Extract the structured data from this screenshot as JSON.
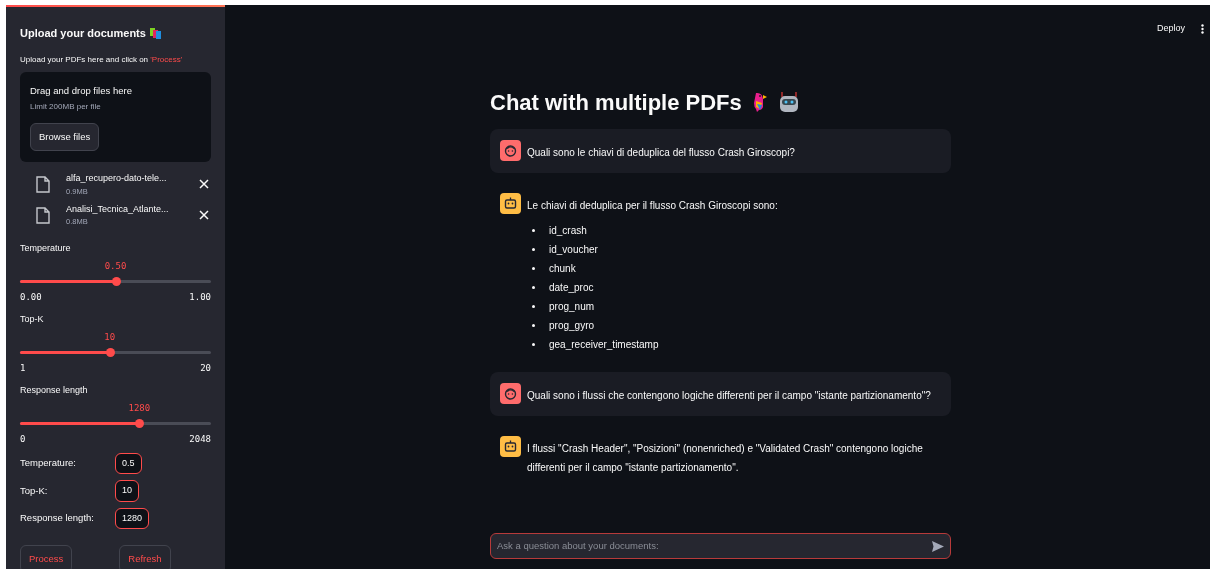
{
  "sidebar": {
    "title": "Upload your documents",
    "hint": {
      "text": "Upload your PDFs here and click on ",
      "highlight": "'Process'"
    },
    "dropzone": {
      "title": "Drag and drop files here",
      "limit": "Limit 200MB per file",
      "button": "Browse files"
    },
    "files": [
      {
        "name": "alfa_recupero-dato-tele...",
        "size": "0.9MB"
      },
      {
        "name": "Analisi_Tecnica_Atlante...",
        "size": "0.8MB"
      }
    ],
    "sliders": [
      {
        "label": "Temperature",
        "reading": "0.50",
        "min": "0.00",
        "max": "1.00",
        "level": 0.5
      },
      {
        "label": "Top-K",
        "reading": "10",
        "min": "1",
        "max": "20",
        "level": 0.47
      },
      {
        "label": "Response length",
        "reading": "1280",
        "min": "0",
        "max": "2048",
        "level": 0.625
      }
    ],
    "values": [
      {
        "label": "Temperature:",
        "value": "0.5"
      },
      {
        "label": "Top-K:",
        "value": "10"
      },
      {
        "label": "Response length:",
        "value": "1280"
      }
    ],
    "buttons": [
      "Process",
      "Refresh"
    ]
  },
  "toolbar": {
    "deploy": "Deploy"
  },
  "main": {
    "title": "Chat with multiple PDFs",
    "messages": [
      {
        "kind": "user",
        "text": "Quali sono le chiavi di deduplica del flusso Crash Giroscopi?"
      },
      {
        "kind": "assistant",
        "text": "Le chiavi di deduplica per il flusso Crash Giroscopi sono:",
        "items": [
          "id_crash",
          "id_voucher",
          "chunk",
          "date_proc",
          "prog_num",
          "prog_gyro",
          "gea_receiver_timestamp"
        ]
      },
      {
        "kind": "user",
        "text": "Quali sono i flussi che contengono logiche differenti per il campo \"istante partizionamento\"?"
      },
      {
        "kind": "assistant",
        "text": "I flussi \"Crash Header\", \"Posizioni\" (nonenriched) e \"Validated Crash\" contengono logiche differenti per il campo \"istante partizionamento\"."
      }
    ],
    "input": {
      "placeholder": "Ask a question about your documents:"
    }
  }
}
